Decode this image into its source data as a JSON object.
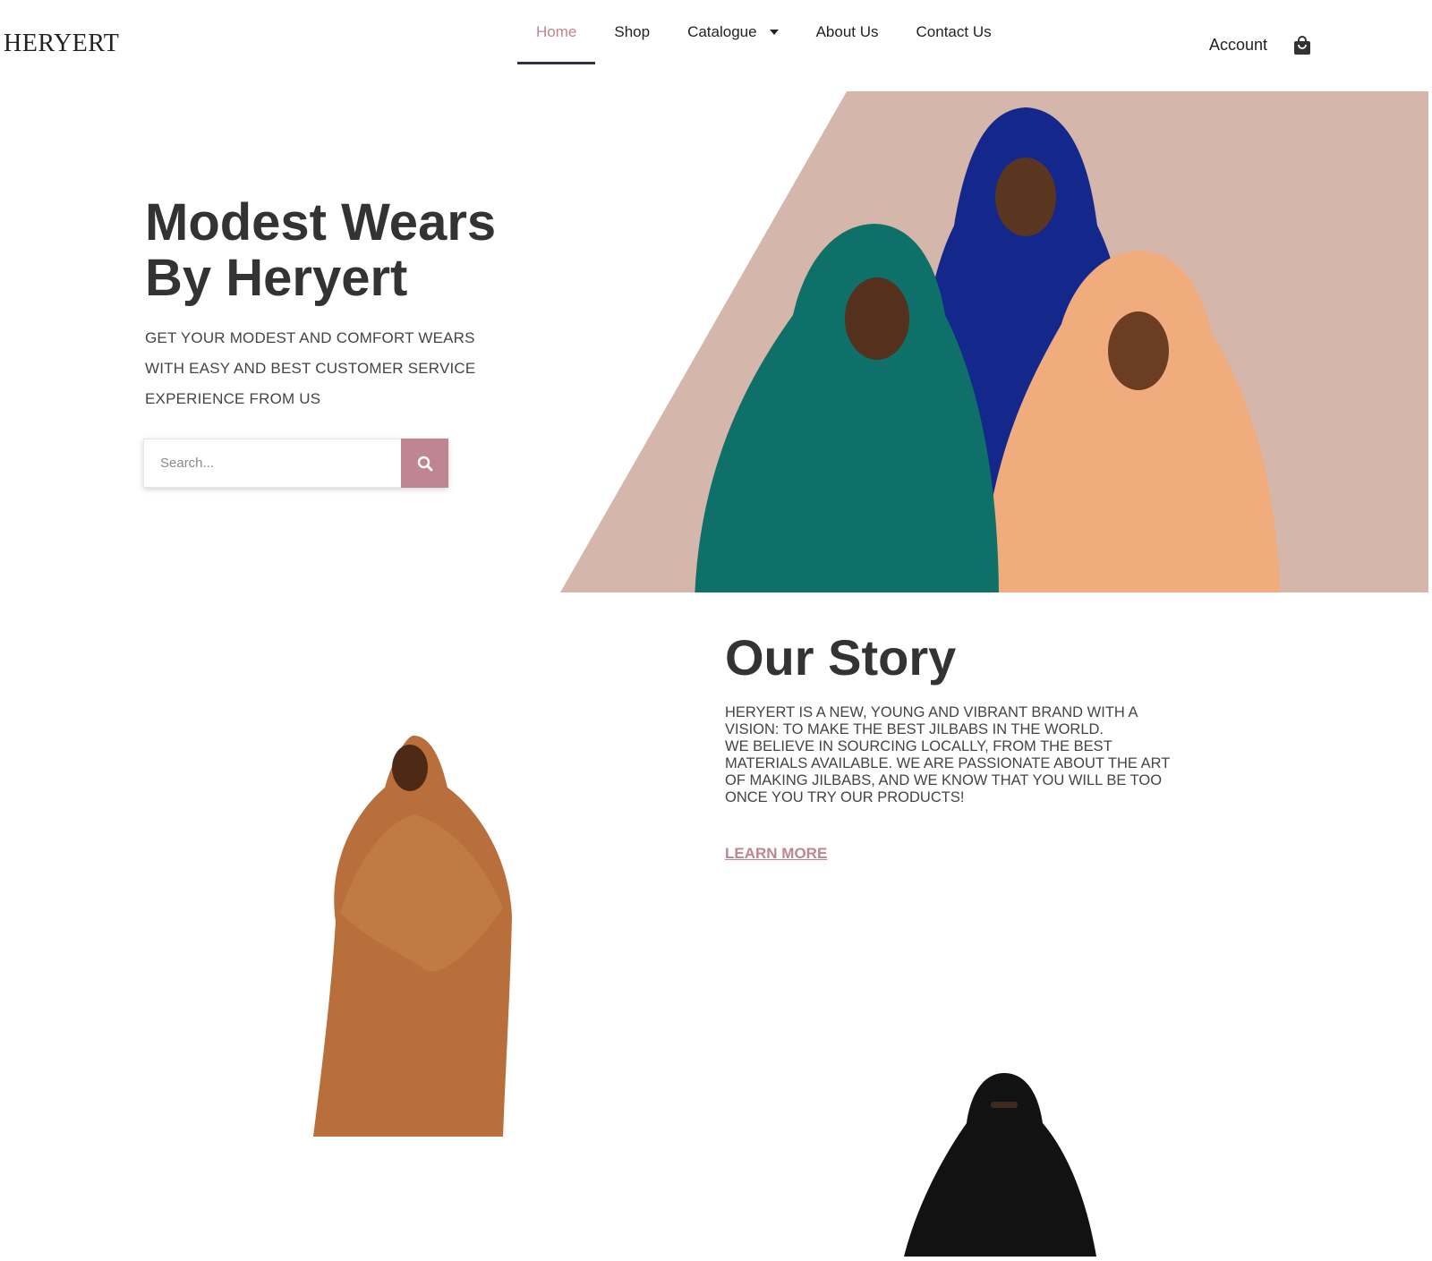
{
  "header": {
    "logo": "HERYERT",
    "nav": [
      {
        "label": "Home",
        "active": true
      },
      {
        "label": "Shop"
      },
      {
        "label": "Catalogue",
        "has_dropdown": true
      },
      {
        "label": "About Us"
      },
      {
        "label": "Contact Us"
      }
    ],
    "account_label": "Account",
    "cart_icon": "shopping-bag-icon"
  },
  "hero": {
    "title": "Modest Wears By Heryert",
    "subtitle_lines": [
      "GET YOUR MODEST AND COMFORT WEARS",
      " WITH EASY AND BEST CUSTOMER SERVICE",
      " EXPERIENCE FROM US"
    ],
    "search": {
      "placeholder": "Search...",
      "value": "",
      "button_icon": "search-icon"
    },
    "image_alt": "three women wearing teal, blue and peach hijabs",
    "background_color": "#d5b6ab"
  },
  "story": {
    "title": "Our Story",
    "text": "HERYERT IS A NEW, YOUNG AND VIBRANT BRAND WITH A\nVISION: TO MAKE THE BEST JILBABS IN THE WORLD.\nWE BELIEVE IN SOURCING LOCALLY, FROM THE BEST\nMATERIALS AVAILABLE. WE ARE PASSIONATE ABOUT THE ART\nOF MAKING JILBABS, AND WE KNOW THAT YOU WILL BE TOO\nONCE YOU TRY OUR PRODUCTS!",
    "link_label": "LEARN MORE"
  },
  "colors": {
    "accent": "#bf8590",
    "accent_text": "#c4848e",
    "hero_bg": "#d5b6ab",
    "heading": "#333333",
    "nav_underline": "#2e3440"
  }
}
